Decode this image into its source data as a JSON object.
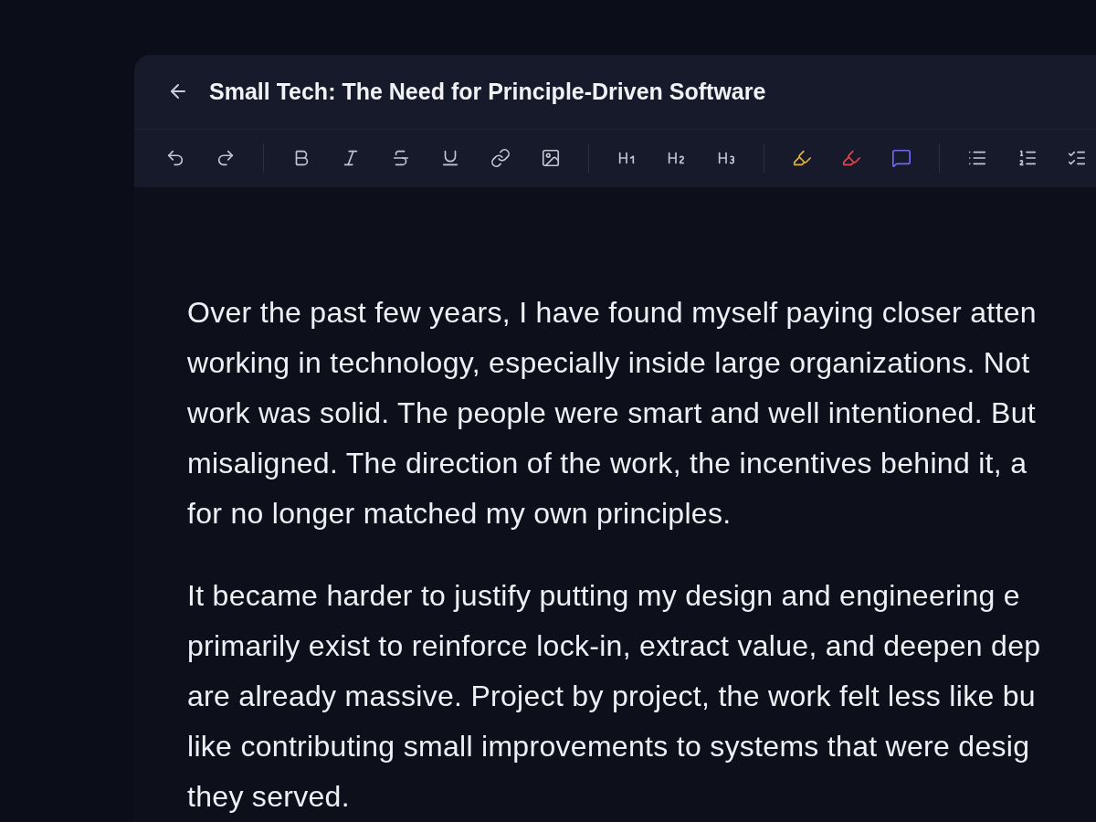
{
  "document": {
    "title": "Small Tech: The Need for Principle-Driven Software"
  },
  "toolbar": {
    "groups": [
      [
        {
          "kind": "undo"
        },
        {
          "kind": "redo"
        }
      ],
      [
        {
          "kind": "bold"
        },
        {
          "kind": "italic"
        },
        {
          "kind": "strike"
        },
        {
          "kind": "underline"
        },
        {
          "kind": "link"
        },
        {
          "kind": "image"
        }
      ],
      [
        {
          "kind": "h1"
        },
        {
          "kind": "h2"
        },
        {
          "kind": "h3"
        }
      ],
      [
        {
          "kind": "highlight",
          "color": "#e5b53a"
        },
        {
          "kind": "highlight",
          "color": "#e5484d"
        },
        {
          "kind": "comment",
          "color": "#6e6af5"
        }
      ],
      [
        {
          "kind": "bullets"
        },
        {
          "kind": "numbered"
        },
        {
          "kind": "checklist"
        }
      ]
    ]
  },
  "paragraphs": [
    {
      "lines": [
        "Over the past few years, I have found myself paying closer atten",
        "working in technology, especially inside large organizations. Not",
        "work was solid. The people were smart and well intentioned. But",
        "misaligned. The direction of the work, the incentives behind it, a",
        "for no longer matched my own principles."
      ]
    },
    {
      "lines": [
        "It became harder to justify putting my design and engineering e",
        "primarily exist to reinforce lock-in, extract value, and deepen dep",
        "are already massive. Project by project, the work felt less like bu",
        "like contributing small improvements to systems that were desig",
        "they served."
      ]
    }
  ]
}
